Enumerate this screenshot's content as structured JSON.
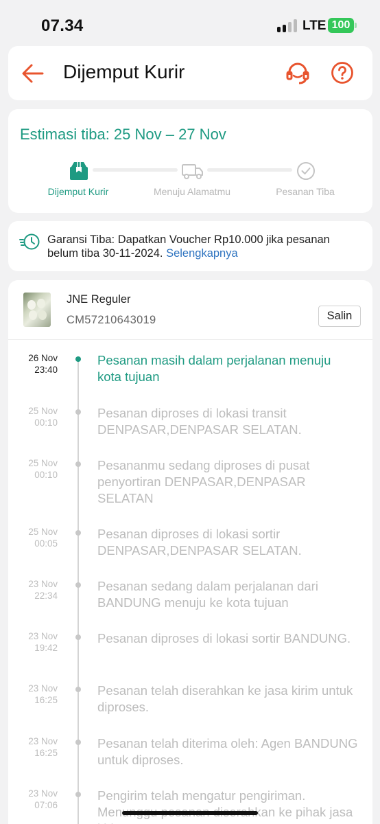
{
  "status_bar": {
    "time": "07.34",
    "network": "LTE",
    "battery": "100"
  },
  "header": {
    "title": "Dijemput Kurir"
  },
  "estimate": {
    "title": "Estimasi tiba: 25 Nov – 27 Nov",
    "steps": [
      {
        "label": "Dijemput Kurir",
        "icon": "box-icon",
        "active": true
      },
      {
        "label": "Menuju Alamatmu",
        "icon": "truck-icon",
        "active": false
      },
      {
        "label": "Pesanan Tiba",
        "icon": "check-circle-icon",
        "active": false
      }
    ]
  },
  "guarantee": {
    "text": "Garansi Tiba: Dapatkan Voucher Rp10.000 jika pesanan belum tiba 30-11-2024.",
    "link": "Selengkapnya"
  },
  "shipment": {
    "courier": "JNE Reguler",
    "tracking_number": "CM57210643019",
    "copy_label": "Salin"
  },
  "events": [
    {
      "date": "26 Nov",
      "time": "23:40",
      "desc": "Pesanan masih dalam perjalanan menuju kota tujuan",
      "active": true
    },
    {
      "date": "25 Nov",
      "time": "00:10",
      "desc": "Pesanan diproses di lokasi transit DENPASAR,DENPASAR SELATAN."
    },
    {
      "date": "25 Nov",
      "time": "00:10",
      "desc": "Pesananmu sedang diproses di pusat penyortiran DENPASAR,DENPASAR SELATAN"
    },
    {
      "date": "25 Nov",
      "time": "00:05",
      "desc": "Pesanan diproses di lokasi sortir DENPASAR,DENPASAR SELATAN."
    },
    {
      "date": "23 Nov",
      "time": "22:34",
      "desc": "Pesanan sedang dalam perjalanan dari BANDUNG menuju ke kota tujuan"
    },
    {
      "date": "23 Nov",
      "time": "19:42",
      "desc": "Pesanan diproses di lokasi sortir BANDUNG."
    },
    {
      "date": "23 Nov",
      "time": "16:25",
      "desc": "Pesanan telah diserahkan ke jasa kirim untuk diproses."
    },
    {
      "date": "23 Nov",
      "time": "16:25",
      "desc": "Pesanan telah diterima oleh: Agen BANDUNG untuk diproses."
    },
    {
      "date": "23 Nov",
      "time": "07:06",
      "desc": "Pengirim telah mengatur pengiriman. Menunggu pesanan diserahkan ke pihak jasa kirim."
    }
  ],
  "colors": {
    "accent": "#1e9a82",
    "header_icons": "#e8542e",
    "link": "#2f74c0",
    "muted": "#bdbdbd"
  }
}
